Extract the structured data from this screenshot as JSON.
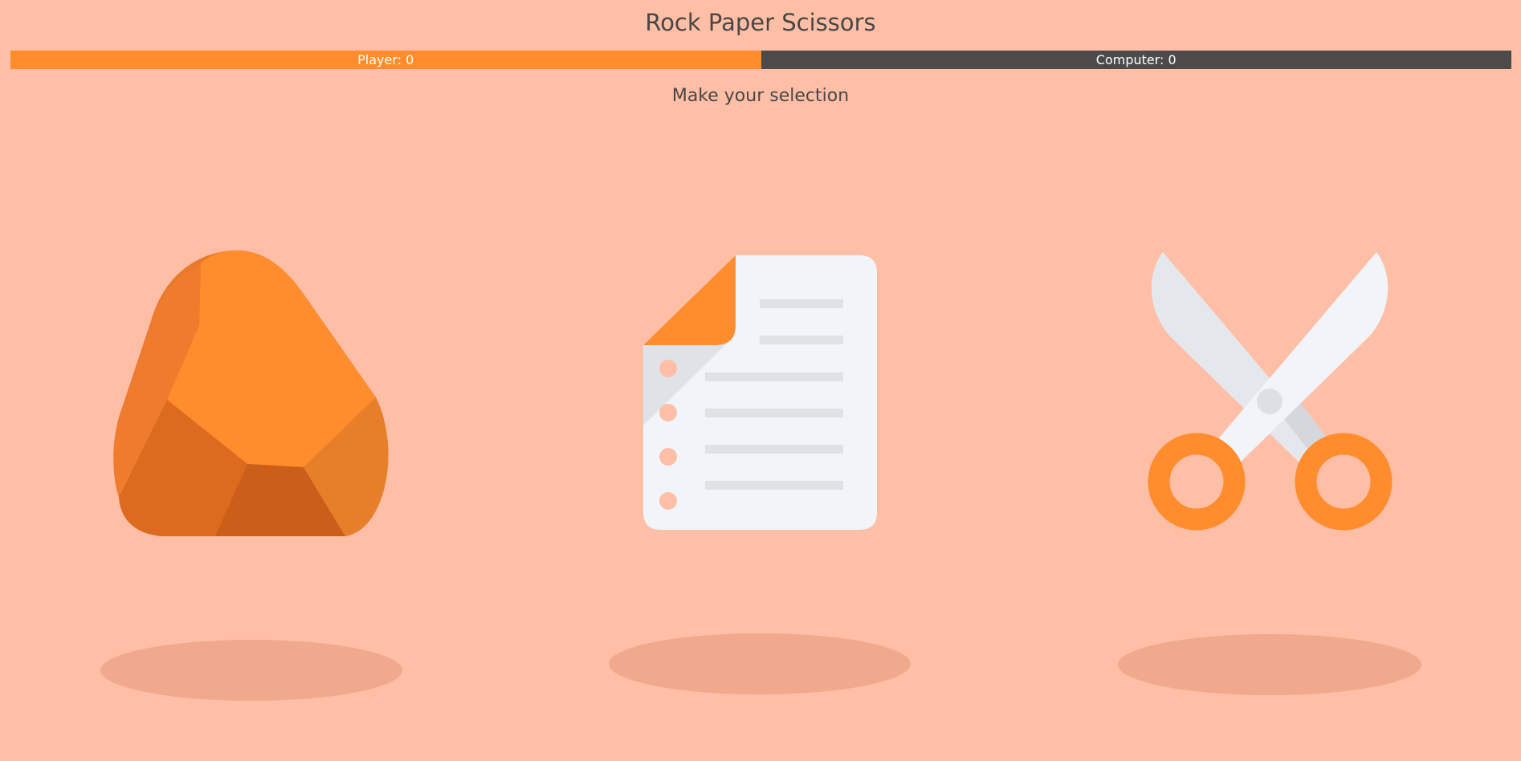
{
  "game": {
    "title": "Rock Paper Scissors",
    "prompt": "Make your selection"
  },
  "scoreboard": {
    "player_label": "Player: 0",
    "computer_label": "Computer: 0",
    "player_score": 0,
    "computer_score": 0,
    "player_color": "#ff8c2d",
    "computer_color": "#4c4b4a"
  },
  "choices": [
    {
      "id": "rock",
      "icon": "rock-icon"
    },
    {
      "id": "paper",
      "icon": "paper-icon"
    },
    {
      "id": "scissors",
      "icon": "scissors-icon"
    }
  ],
  "colors": {
    "background": "#ffbea6",
    "accent": "#ff8c2d",
    "shadow": "#f0a98d"
  }
}
